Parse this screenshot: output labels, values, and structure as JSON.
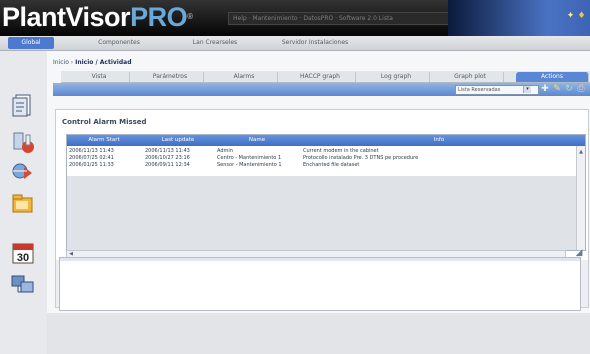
{
  "header": {
    "logo_a": "Plant",
    "logo_b": "Visor",
    "logo_c": "PRO",
    "info_text": "Help · Mantenimiento · DatosPRO · Software 2.0 Lista"
  },
  "topnav": [
    {
      "label": "Global",
      "active": true
    },
    {
      "label": "Componentes",
      "active": false
    },
    {
      "label": "Lan Crearseles",
      "active": false
    },
    {
      "label": "Servidor Instalaciones",
      "active": false
    }
  ],
  "breadcrumb": {
    "prefix": "Inicio",
    "current": "Inicio / Actividad"
  },
  "subtabs": [
    "Vista",
    "Parámetros",
    "Alarms",
    "HACCP graph",
    "Log graph",
    "Graph plot",
    "Actions"
  ],
  "toolbar": {
    "select_value": "Lista Reservadas",
    "select_arrow": "▾"
  },
  "panel": {
    "title": "Control Alarm Missed"
  },
  "grid": {
    "columns": [
      "Alarm Start",
      "Last update",
      "Name",
      "Info"
    ],
    "rows": [
      [
        "2006/11/13 11:43",
        "2006/11/13 11:43",
        "Admin",
        "Current modem in the cabinet"
      ],
      [
        "2006/07/25 02:41",
        "2006/10/27 23:16",
        "Centro - Mantenimiento 1",
        "Protocollo instalado Pre. 3 DTNS pe procedure"
      ],
      [
        "2006/01/25 11:33",
        "2006/09/11 12:34",
        "Sensor - Mantenimiento 1",
        "Enchanted file dataset"
      ]
    ]
  },
  "colors": {
    "accent": "#4b7ad0",
    "header_bg": "#0b0b0b",
    "logo_pro": "#6aa8d8",
    "toolbar": "#7aa1dc"
  },
  "icons": {
    "sidebar": [
      "document-icon",
      "thermometer-icon",
      "cooling-icon",
      "folder-icon",
      "calendar-icon",
      "network-icon"
    ],
    "calendar_day": "30"
  }
}
